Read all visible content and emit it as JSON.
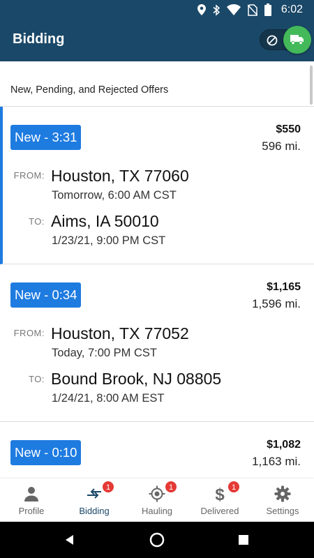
{
  "status_bar": {
    "time": "6:02",
    "icons": [
      "location-icon",
      "bluetooth-icon",
      "wifi-icon",
      "no-sim-icon",
      "battery-icon"
    ]
  },
  "app_bar": {
    "title": "Bidding",
    "availability_toggle": {
      "on": true,
      "on_icon": "truck-icon",
      "off_icon": "blocked-icon",
      "accent_color": "#43b95a"
    }
  },
  "section": {
    "title": "New, Pending, and Rejected Offers"
  },
  "offers": [
    {
      "status": "New - 3:31",
      "price": "$550",
      "distance": "596 mi.",
      "from_label": "FROM:",
      "from_city": "Houston, TX 77060",
      "from_time": "Tomorrow, 6:00 AM CST",
      "to_label": "TO:",
      "to_city": "Aims, IA 50010",
      "to_time": "1/23/21, 9:00 PM CST"
    },
    {
      "status": "New - 0:34",
      "price": "$1,165",
      "distance": "1,596 mi.",
      "from_label": "FROM:",
      "from_city": "Houston, TX 77052",
      "from_time": "Today, 7:00 PM CST",
      "to_label": "TO:",
      "to_city": "Bound Brook, NJ 08805",
      "to_time": "1/24/21, 8:00 AM EST"
    },
    {
      "status": "New - 0:10",
      "price": "$1,082",
      "distance": "1,163 mi."
    }
  ],
  "bottom_nav": {
    "items": [
      {
        "label": "Profile",
        "icon": "person-icon"
      },
      {
        "label": "Bidding",
        "icon": "swap-arrows-icon",
        "badge": "1",
        "active": true
      },
      {
        "label": "Hauling",
        "icon": "gps-target-icon",
        "badge": "1"
      },
      {
        "label": "Delivered",
        "icon": "dollar-icon",
        "badge": "1"
      },
      {
        "label": "Settings",
        "icon": "gear-icon"
      }
    ]
  },
  "colors": {
    "primary": "#1a4868",
    "accent": "#1e7be0",
    "badge": "#e53935",
    "toggle_on": "#43b95a"
  }
}
